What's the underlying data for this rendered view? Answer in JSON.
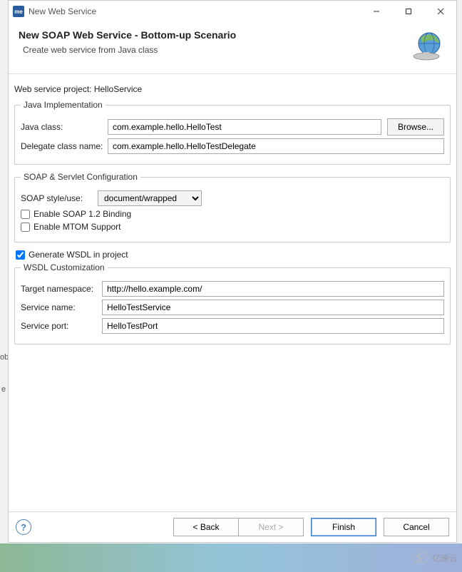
{
  "window": {
    "title": "New Web Service",
    "app_icon_text": "me"
  },
  "header": {
    "title": "New SOAP Web Service - Bottom-up Scenario",
    "subtitle": "Create web service from Java class"
  },
  "project": {
    "label": "Web service project:",
    "value": "HelloService"
  },
  "java_impl": {
    "legend": "Java Implementation",
    "java_class_label": "Java class:",
    "java_class_value": "com.example.hello.HelloTest",
    "browse_label": "Browse...",
    "delegate_label": "Delegate class name:",
    "delegate_value": "com.example.hello.HelloTestDelegate"
  },
  "soap": {
    "legend": "SOAP & Servlet Configuration",
    "style_label": "SOAP style/use:",
    "style_value": "document/wrapped",
    "enable_soap12_label": "Enable SOAP 1.2 Binding",
    "enable_soap12_checked": false,
    "enable_mtom_label": "Enable MTOM Support",
    "enable_mtom_checked": false
  },
  "wsdl_gen": {
    "label": "Generate WSDL in project",
    "checked": true
  },
  "wsdl_custom": {
    "legend": "WSDL Customization",
    "target_ns_label": "Target namespace:",
    "target_ns_value": "http://hello.example.com/",
    "service_name_label": "Service name:",
    "service_name_value": "HelloTestService",
    "service_port_label": "Service port:",
    "service_port_value": "HelloTestPort"
  },
  "footer": {
    "back": "< Back",
    "next": "Next >",
    "finish": "Finish",
    "cancel": "Cancel"
  },
  "watermark": "亿速云"
}
